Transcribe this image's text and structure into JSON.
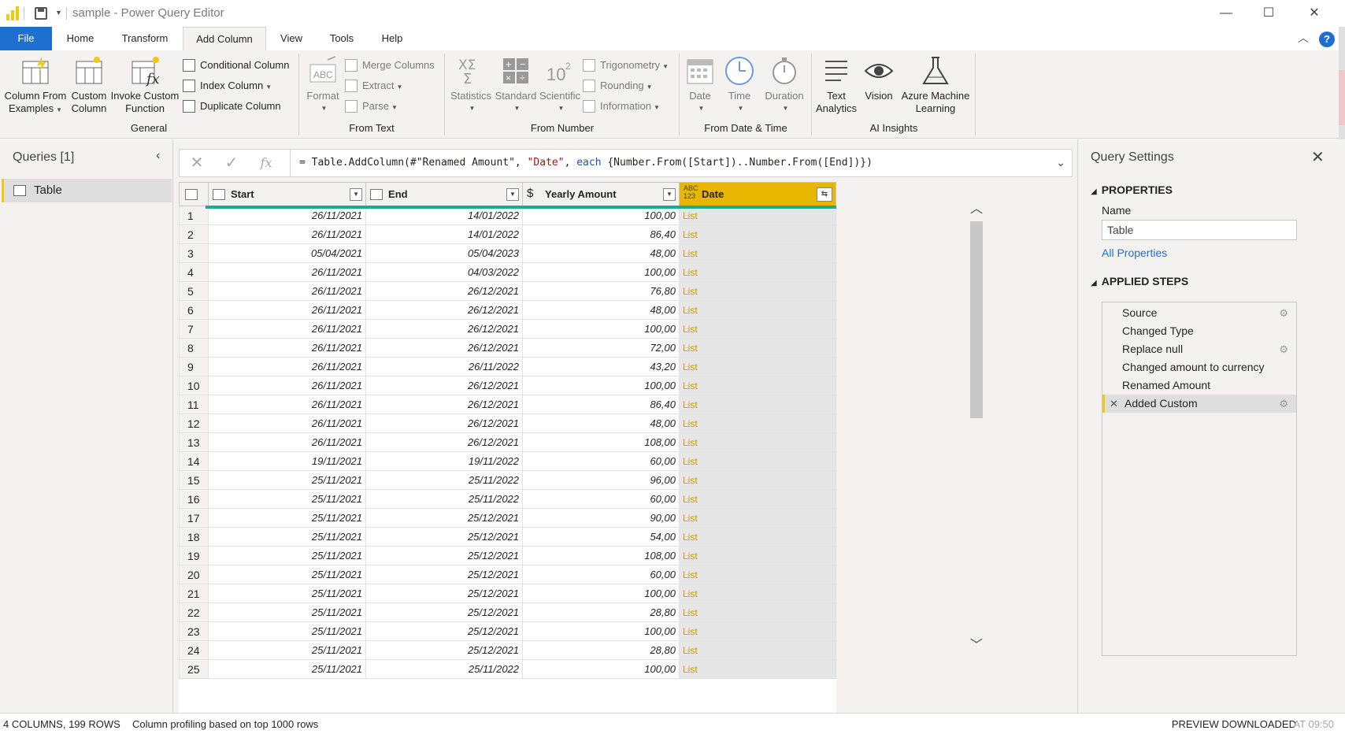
{
  "window": {
    "title": "sample - Power Query Editor",
    "minimize": "—",
    "maximize": "☐",
    "close": "✕"
  },
  "tabs": {
    "file": "File",
    "home": "Home",
    "transform": "Transform",
    "add_column": "Add Column",
    "view": "View",
    "tools": "Tools",
    "help": "Help"
  },
  "ribbon": {
    "general": {
      "label": "General",
      "column_from_examples": "Column From",
      "column_from_examples_2": "Examples",
      "custom_column": "Custom",
      "custom_column_2": "Column",
      "invoke_custom_function": "Invoke Custom",
      "invoke_custom_function_2": "Function",
      "conditional_column": "Conditional Column",
      "index_column": "Index Column",
      "duplicate_column": "Duplicate Column"
    },
    "from_text": {
      "label": "From Text",
      "format": "Format",
      "merge_columns": "Merge Columns",
      "extract": "Extract",
      "parse": "Parse"
    },
    "from_number": {
      "label": "From Number",
      "statistics": "Statistics",
      "standard": "Standard",
      "scientific": "Scientific",
      "trigonometry": "Trigonometry",
      "rounding": "Rounding",
      "information": "Information"
    },
    "from_date_time": {
      "label": "From Date & Time",
      "date": "Date",
      "time": "Time",
      "duration": "Duration"
    },
    "ai_insights": {
      "label": "AI Insights",
      "text_analytics": "Text",
      "text_analytics_2": "Analytics",
      "vision": "Vision",
      "azure_ml": "Azure Machine",
      "azure_ml_2": "Learning"
    }
  },
  "queries": {
    "title": "Queries [1]",
    "items": [
      {
        "label": "Table"
      }
    ]
  },
  "formula": {
    "prefix": "= Table.AddColumn(#\"Renamed Amount\", ",
    "str1": "\"Date\"",
    "sep": ", ",
    "kw": "each",
    "rest": " {Number.From([Start])..Number.From([End])})"
  },
  "table": {
    "columns": [
      "Start",
      "End",
      "Yearly Amount",
      "Date"
    ],
    "rows": [
      [
        "1",
        "26/11/2021",
        "14/01/2022",
        "100,00",
        "List"
      ],
      [
        "2",
        "26/11/2021",
        "14/01/2022",
        "86,40",
        "List"
      ],
      [
        "3",
        "05/04/2021",
        "05/04/2023",
        "48,00",
        "List"
      ],
      [
        "4",
        "26/11/2021",
        "04/03/2022",
        "100,00",
        "List"
      ],
      [
        "5",
        "26/11/2021",
        "26/12/2021",
        "76,80",
        "List"
      ],
      [
        "6",
        "26/11/2021",
        "26/12/2021",
        "48,00",
        "List"
      ],
      [
        "7",
        "26/11/2021",
        "26/12/2021",
        "100,00",
        "List"
      ],
      [
        "8",
        "26/11/2021",
        "26/12/2021",
        "72,00",
        "List"
      ],
      [
        "9",
        "26/11/2021",
        "26/11/2022",
        "43,20",
        "List"
      ],
      [
        "10",
        "26/11/2021",
        "26/12/2021",
        "100,00",
        "List"
      ],
      [
        "11",
        "26/11/2021",
        "26/12/2021",
        "86,40",
        "List"
      ],
      [
        "12",
        "26/11/2021",
        "26/12/2021",
        "48,00",
        "List"
      ],
      [
        "13",
        "26/11/2021",
        "26/12/2021",
        "108,00",
        "List"
      ],
      [
        "14",
        "19/11/2021",
        "19/11/2022",
        "60,00",
        "List"
      ],
      [
        "15",
        "25/11/2021",
        "25/11/2022",
        "96,00",
        "List"
      ],
      [
        "16",
        "25/11/2021",
        "25/11/2022",
        "60,00",
        "List"
      ],
      [
        "17",
        "25/11/2021",
        "25/12/2021",
        "90,00",
        "List"
      ],
      [
        "18",
        "25/11/2021",
        "25/12/2021",
        "54,00",
        "List"
      ],
      [
        "19",
        "25/11/2021",
        "25/12/2021",
        "108,00",
        "List"
      ],
      [
        "20",
        "25/11/2021",
        "25/12/2021",
        "60,00",
        "List"
      ],
      [
        "21",
        "25/11/2021",
        "25/12/2021",
        "100,00",
        "List"
      ],
      [
        "22",
        "25/11/2021",
        "25/12/2021",
        "28,80",
        "List"
      ],
      [
        "23",
        "25/11/2021",
        "25/12/2021",
        "100,00",
        "List"
      ],
      [
        "24",
        "25/11/2021",
        "25/12/2021",
        "28,80",
        "List"
      ],
      [
        "25",
        "25/11/2021",
        "25/11/2022",
        "100,00",
        "List"
      ]
    ]
  },
  "settings": {
    "title": "Query Settings",
    "properties": "PROPERTIES",
    "name_label": "Name",
    "name_value": "Table",
    "all_properties": "All Properties",
    "applied_steps": "APPLIED STEPS",
    "steps": [
      {
        "label": "Source",
        "gear": true
      },
      {
        "label": "Changed Type",
        "gear": false
      },
      {
        "label": "Replace null",
        "gear": true
      },
      {
        "label": "Changed amount to currency",
        "gear": false
      },
      {
        "label": "Renamed Amount",
        "gear": false
      },
      {
        "label": "Added Custom",
        "gear": true,
        "selected": true
      }
    ]
  },
  "status": {
    "columns_rows": "4 COLUMNS, 199 ROWS",
    "profiling": "Column profiling based on top 1000 rows",
    "preview": "PREVIEW DOWNLOADED",
    "time": "AT 09:50"
  },
  "colors": {
    "accent_blue": "#1f6fd1",
    "powerbi_yellow": "#f2c811",
    "date_header": "#e8b500",
    "quality_bar": "#1fa896",
    "list_text": "#d09b00"
  }
}
